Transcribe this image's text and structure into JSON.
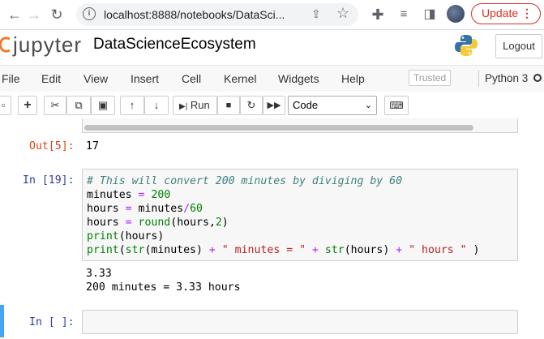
{
  "browser": {
    "url": "localhost:8888/notebooks/DataSci...",
    "update_label": "Update",
    "update_dots": "⋮"
  },
  "header": {
    "logo_text": "jupyter",
    "notebook_title": "DataScienceEcosystem",
    "logout_label": "Logout"
  },
  "menubar": {
    "items": [
      "File",
      "Edit",
      "View",
      "Insert",
      "Cell",
      "Kernel",
      "Widgets",
      "Help"
    ],
    "trusted_label": "Trusted",
    "kernel_name": "Python 3"
  },
  "toolbar": {
    "run_label": "Run",
    "cell_type": "Code"
  },
  "cells": {
    "prev_output_prompt": "Out[5]:",
    "prev_output_value": "17",
    "code_cell_prompt": "In [19]:",
    "code_lines": [
      "# This will convert 200 minutes by diviging by 60",
      "minutes = 200",
      "hours = minutes/60",
      "hours = round(hours,2)",
      "print(hours)",
      "print(str(minutes) + \" minutes = \" + str(hours) + \" hours \" )"
    ],
    "code_output_lines": [
      "3.33",
      "200 minutes = 3.33 hours"
    ],
    "empty_cell_prompt": "In [ ]:"
  },
  "colors": {
    "output_prompt": "#d84315",
    "input_prompt": "#303f9f",
    "selected_cell_bar": "#42a5f5",
    "update_red": "#d93025"
  }
}
